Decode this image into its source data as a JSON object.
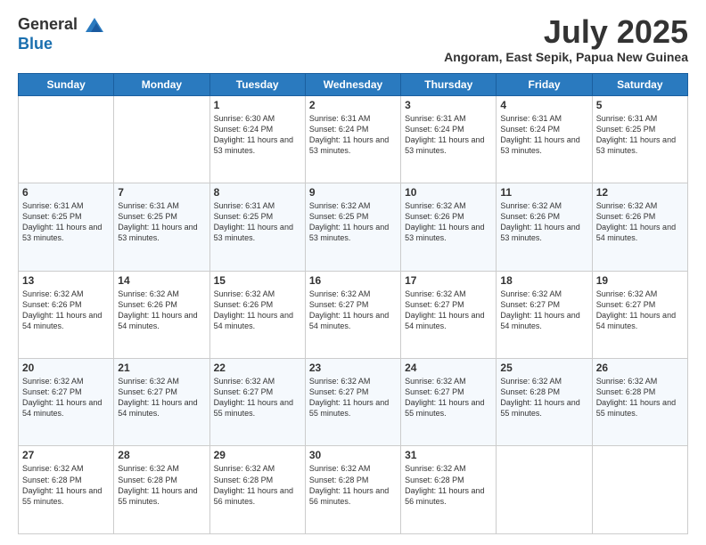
{
  "header": {
    "logo_line1": "General",
    "logo_line2": "Blue",
    "month": "July 2025",
    "location": "Angoram, East Sepik, Papua New Guinea"
  },
  "days_of_week": [
    "Sunday",
    "Monday",
    "Tuesday",
    "Wednesday",
    "Thursday",
    "Friday",
    "Saturday"
  ],
  "weeks": [
    [
      {
        "day": null
      },
      {
        "day": null
      },
      {
        "day": "1",
        "sunrise": "6:30 AM",
        "sunset": "6:24 PM",
        "daylight": "11 hours and 53 minutes."
      },
      {
        "day": "2",
        "sunrise": "6:31 AM",
        "sunset": "6:24 PM",
        "daylight": "11 hours and 53 minutes."
      },
      {
        "day": "3",
        "sunrise": "6:31 AM",
        "sunset": "6:24 PM",
        "daylight": "11 hours and 53 minutes."
      },
      {
        "day": "4",
        "sunrise": "6:31 AM",
        "sunset": "6:24 PM",
        "daylight": "11 hours and 53 minutes."
      },
      {
        "day": "5",
        "sunrise": "6:31 AM",
        "sunset": "6:25 PM",
        "daylight": "11 hours and 53 minutes."
      }
    ],
    [
      {
        "day": "6",
        "sunrise": "6:31 AM",
        "sunset": "6:25 PM",
        "daylight": "11 hours and 53 minutes."
      },
      {
        "day": "7",
        "sunrise": "6:31 AM",
        "sunset": "6:25 PM",
        "daylight": "11 hours and 53 minutes."
      },
      {
        "day": "8",
        "sunrise": "6:31 AM",
        "sunset": "6:25 PM",
        "daylight": "11 hours and 53 minutes."
      },
      {
        "day": "9",
        "sunrise": "6:32 AM",
        "sunset": "6:25 PM",
        "daylight": "11 hours and 53 minutes."
      },
      {
        "day": "10",
        "sunrise": "6:32 AM",
        "sunset": "6:26 PM",
        "daylight": "11 hours and 53 minutes."
      },
      {
        "day": "11",
        "sunrise": "6:32 AM",
        "sunset": "6:26 PM",
        "daylight": "11 hours and 53 minutes."
      },
      {
        "day": "12",
        "sunrise": "6:32 AM",
        "sunset": "6:26 PM",
        "daylight": "11 hours and 54 minutes."
      }
    ],
    [
      {
        "day": "13",
        "sunrise": "6:32 AM",
        "sunset": "6:26 PM",
        "daylight": "11 hours and 54 minutes."
      },
      {
        "day": "14",
        "sunrise": "6:32 AM",
        "sunset": "6:26 PM",
        "daylight": "11 hours and 54 minutes."
      },
      {
        "day": "15",
        "sunrise": "6:32 AM",
        "sunset": "6:26 PM",
        "daylight": "11 hours and 54 minutes."
      },
      {
        "day": "16",
        "sunrise": "6:32 AM",
        "sunset": "6:27 PM",
        "daylight": "11 hours and 54 minutes."
      },
      {
        "day": "17",
        "sunrise": "6:32 AM",
        "sunset": "6:27 PM",
        "daylight": "11 hours and 54 minutes."
      },
      {
        "day": "18",
        "sunrise": "6:32 AM",
        "sunset": "6:27 PM",
        "daylight": "11 hours and 54 minutes."
      },
      {
        "day": "19",
        "sunrise": "6:32 AM",
        "sunset": "6:27 PM",
        "daylight": "11 hours and 54 minutes."
      }
    ],
    [
      {
        "day": "20",
        "sunrise": "6:32 AM",
        "sunset": "6:27 PM",
        "daylight": "11 hours and 54 minutes."
      },
      {
        "day": "21",
        "sunrise": "6:32 AM",
        "sunset": "6:27 PM",
        "daylight": "11 hours and 54 minutes."
      },
      {
        "day": "22",
        "sunrise": "6:32 AM",
        "sunset": "6:27 PM",
        "daylight": "11 hours and 55 minutes."
      },
      {
        "day": "23",
        "sunrise": "6:32 AM",
        "sunset": "6:27 PM",
        "daylight": "11 hours and 55 minutes."
      },
      {
        "day": "24",
        "sunrise": "6:32 AM",
        "sunset": "6:27 PM",
        "daylight": "11 hours and 55 minutes."
      },
      {
        "day": "25",
        "sunrise": "6:32 AM",
        "sunset": "6:28 PM",
        "daylight": "11 hours and 55 minutes."
      },
      {
        "day": "26",
        "sunrise": "6:32 AM",
        "sunset": "6:28 PM",
        "daylight": "11 hours and 55 minutes."
      }
    ],
    [
      {
        "day": "27",
        "sunrise": "6:32 AM",
        "sunset": "6:28 PM",
        "daylight": "11 hours and 55 minutes."
      },
      {
        "day": "28",
        "sunrise": "6:32 AM",
        "sunset": "6:28 PM",
        "daylight": "11 hours and 55 minutes."
      },
      {
        "day": "29",
        "sunrise": "6:32 AM",
        "sunset": "6:28 PM",
        "daylight": "11 hours and 56 minutes."
      },
      {
        "day": "30",
        "sunrise": "6:32 AM",
        "sunset": "6:28 PM",
        "daylight": "11 hours and 56 minutes."
      },
      {
        "day": "31",
        "sunrise": "6:32 AM",
        "sunset": "6:28 PM",
        "daylight": "11 hours and 56 minutes."
      },
      {
        "day": null
      },
      {
        "day": null
      }
    ]
  ],
  "labels": {
    "sunrise": "Sunrise:",
    "sunset": "Sunset:",
    "daylight": "Daylight:"
  }
}
